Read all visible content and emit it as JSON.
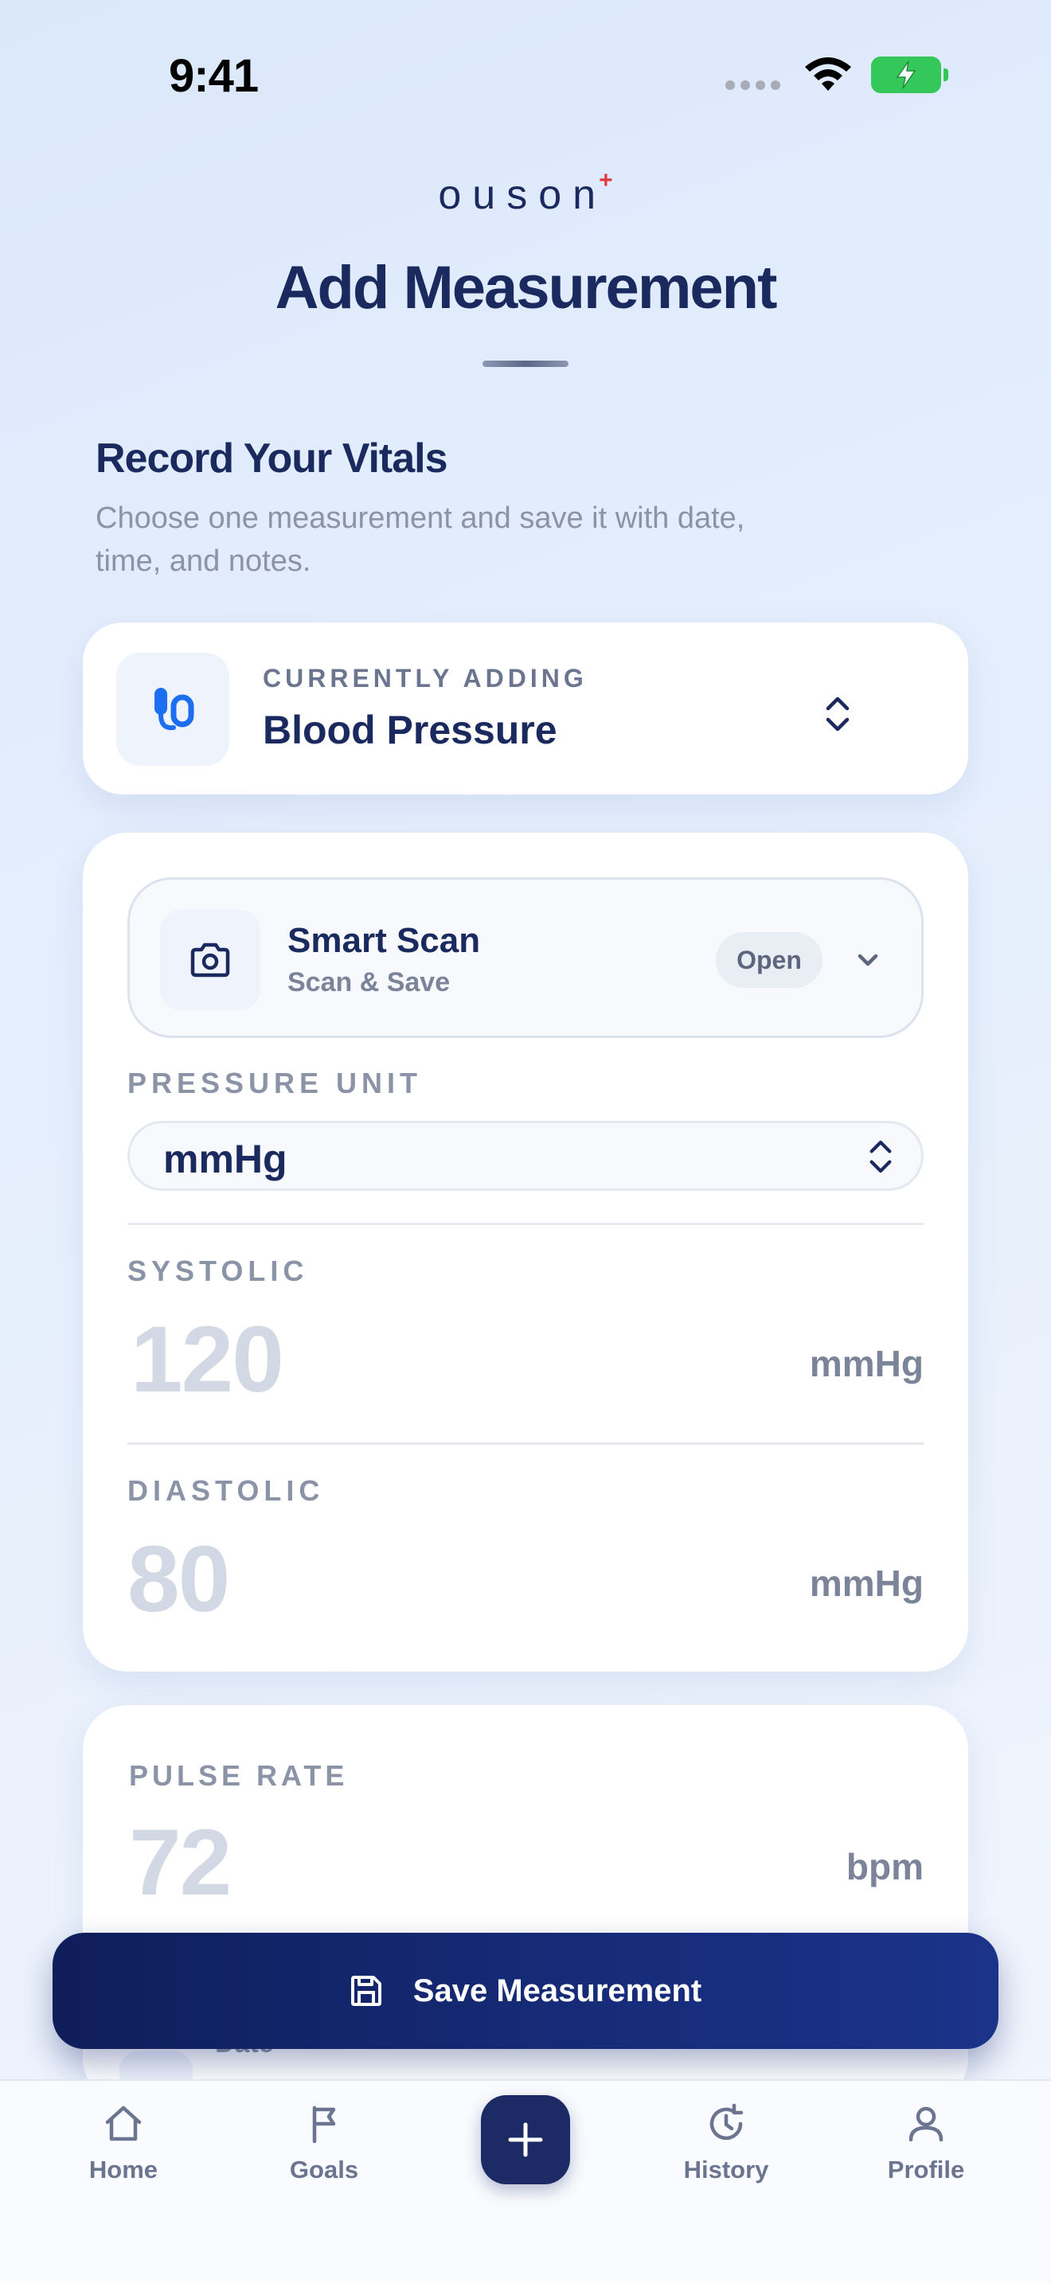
{
  "status_bar": {
    "time": "9:41"
  },
  "header": {
    "brand": "ouson",
    "brand_mark": "+",
    "title": "Add Measurement"
  },
  "intro": {
    "heading": "Record Your Vitals",
    "subtitle": "Choose one measurement and save it with date, time, and notes."
  },
  "current": {
    "label": "CURRENTLY ADDING",
    "value": "Blood Pressure",
    "icon": "blood-pressure-icon"
  },
  "smart_scan": {
    "title": "Smart Scan",
    "subtitle": "Scan & Save",
    "open_label": "Open",
    "icon": "camera-icon"
  },
  "pressure": {
    "unit_label": "PRESSURE UNIT",
    "unit_value": "mmHg",
    "systolic_label": "SYSTOLIC",
    "systolic_placeholder": "120",
    "systolic_unit": "mmHg",
    "diastolic_label": "DIASTOLIC",
    "diastolic_placeholder": "80",
    "diastolic_unit": "mmHg"
  },
  "pulse": {
    "label": "PULSE RATE",
    "placeholder": "72",
    "unit": "bpm"
  },
  "date_row": {
    "label": "Date"
  },
  "save_button": {
    "label": "Save Measurement",
    "icon": "save-icon"
  },
  "tab_bar": {
    "home": "Home",
    "goals": "Goals",
    "history": "History",
    "profile": "Profile"
  },
  "colors": {
    "primary": "#1b2a5e",
    "button": "#162b78",
    "accent_red": "#e03a3a",
    "battery": "#34c759"
  }
}
